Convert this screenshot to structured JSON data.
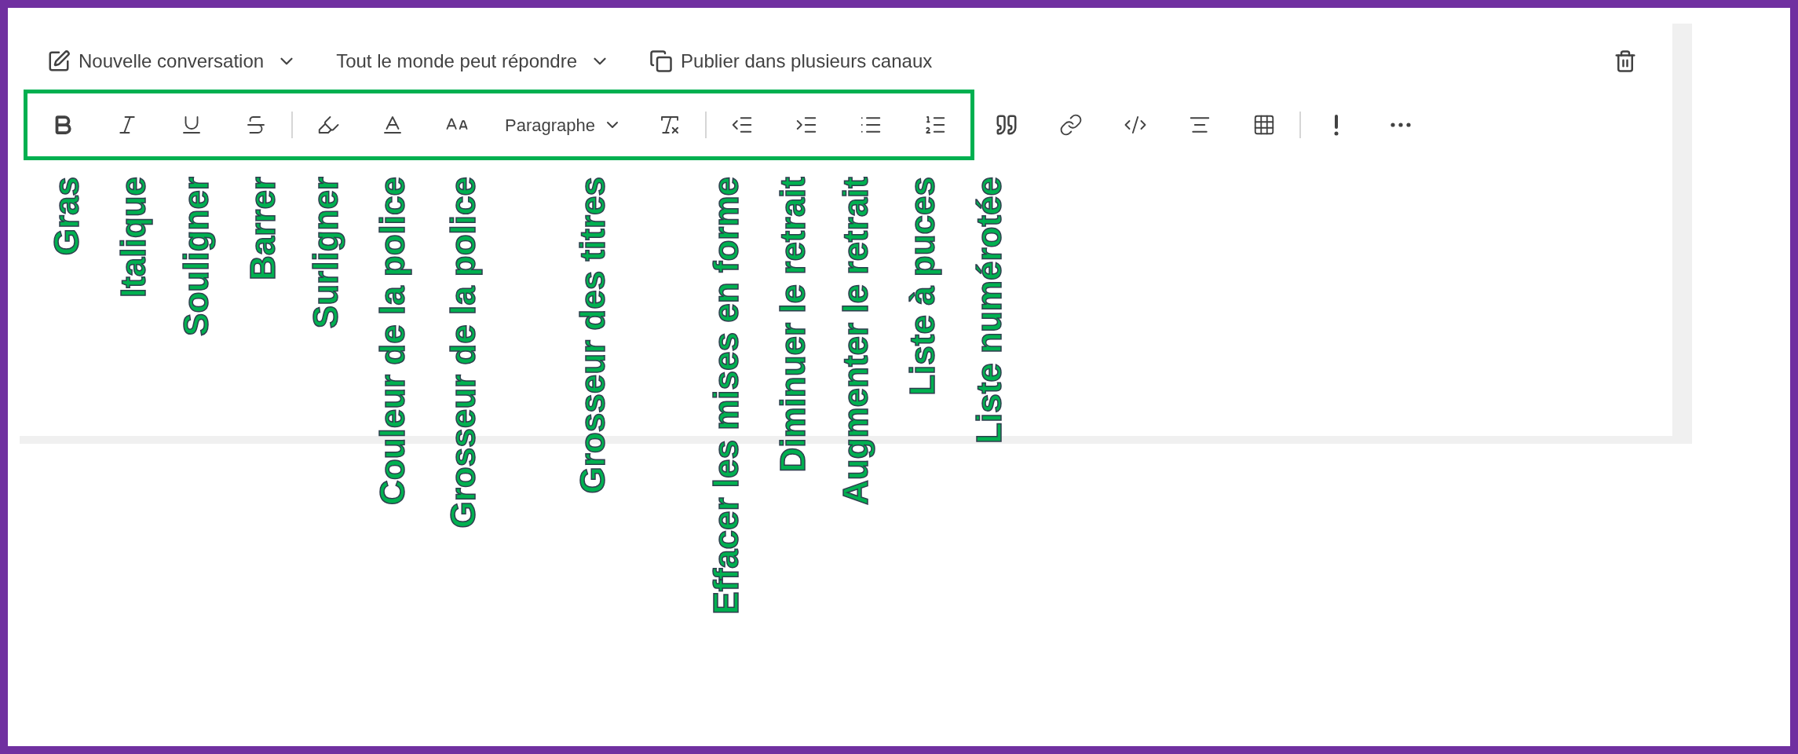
{
  "compose_options": [
    {
      "kind": "new",
      "label": "Nouvelle conversation"
    },
    {
      "kind": "reply",
      "label": "Tout le monde peut répondre"
    },
    {
      "kind": "publish",
      "label": "Publier dans plusieurs canaux"
    }
  ],
  "toolbar": {
    "paragraph_dropdown": {
      "label": "Paragraphe"
    }
  },
  "annotations": [
    "Gras",
    "Italique",
    "Souligner",
    "Barrer",
    "Surligner",
    "Couleur de la police",
    "Grosseur de la police",
    "Grosseur des titres",
    "Effacer les mises en forme",
    "Diminuer le retrait",
    "Augmenter le retrait",
    "Liste à puces",
    "Liste numérotée"
  ]
}
